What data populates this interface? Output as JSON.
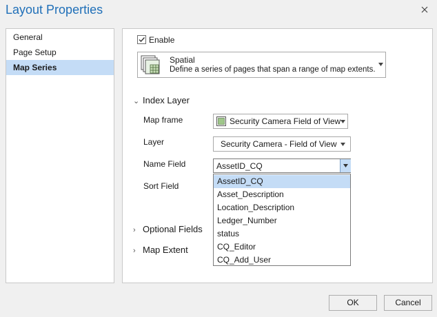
{
  "window": {
    "title": "Layout Properties"
  },
  "icons": {
    "close": "close-icon"
  },
  "sidebar": {
    "items": [
      {
        "label": "General"
      },
      {
        "label": "Page Setup"
      },
      {
        "label": "Map Series",
        "selected": true
      }
    ]
  },
  "enable": {
    "label": "Enable",
    "checked": true
  },
  "series_type": {
    "title": "Spatial",
    "description": "Define a series of pages that span a range of map extents."
  },
  "index_layer": {
    "heading": "Index Layer",
    "map_frame_label": "Map frame",
    "map_frame_value": "Security Camera Field of View",
    "layer_label": "Layer",
    "layer_value": "Security Camera - Field of View",
    "name_field_label": "Name Field",
    "name_field_value": "AssetID_CQ",
    "sort_field_label": "Sort Field"
  },
  "dropdown": {
    "options": [
      "AssetID_CQ",
      "Asset_Description",
      "Location_Description",
      "Ledger_Number",
      "status",
      "CQ_Editor",
      "CQ_Add_User"
    ],
    "selected_index": 0
  },
  "optional_fields": {
    "heading": "Optional Fields"
  },
  "map_extent": {
    "heading": "Map Extent"
  },
  "buttons": {
    "ok": "OK",
    "cancel": "Cancel"
  },
  "colors": {
    "title": "#1f6fb8",
    "selection": "#c4dcf6"
  }
}
